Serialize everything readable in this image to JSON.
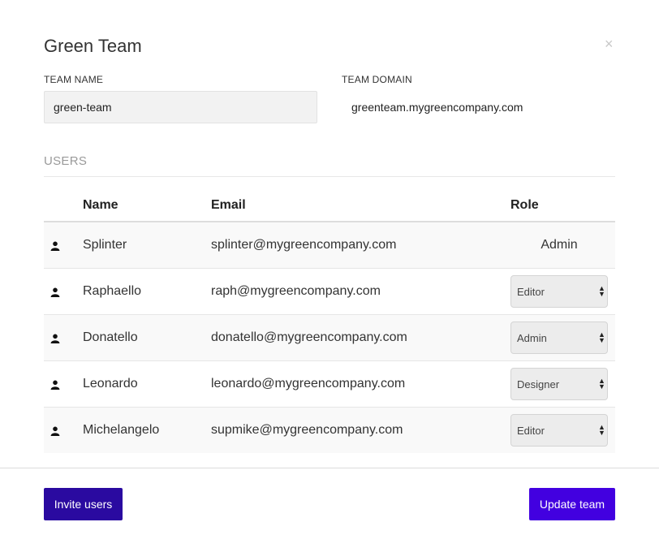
{
  "modal": {
    "title": "Green Team",
    "close_glyph": "×"
  },
  "fields": {
    "team_name_label": "TEAM NAME",
    "team_name_value": "green-team",
    "team_domain_label": "TEAM DOMAIN",
    "team_domain_value": "greenteam.mygreencompany.com"
  },
  "users": {
    "section_title": "USERS",
    "columns": {
      "name": "Name",
      "email": "Email",
      "role": "Role"
    },
    "rows": [
      {
        "name": "Splinter",
        "email": "splinter@mygreencompany.com",
        "role": "Admin",
        "role_editable": false
      },
      {
        "name": "Raphaello",
        "email": "raph@mygreencompany.com",
        "role": "Editor",
        "role_editable": true
      },
      {
        "name": "Donatello",
        "email": "donatello@mygreencompany.com",
        "role": "Admin",
        "role_editable": true
      },
      {
        "name": "Leonardo",
        "email": "leonardo@mygreencompany.com",
        "role": "Designer",
        "role_editable": true
      },
      {
        "name": "Michelangelo",
        "email": "supmike@mygreencompany.com",
        "role": "Editor",
        "role_editable": true
      }
    ],
    "row_icon": "user-icon"
  },
  "footer": {
    "invite_label": "Invite users",
    "update_label": "Update team"
  },
  "colors": {
    "invite_button": "#2a0aa0",
    "update_button": "#4200e0",
    "section_title": "#9a9a9a"
  }
}
